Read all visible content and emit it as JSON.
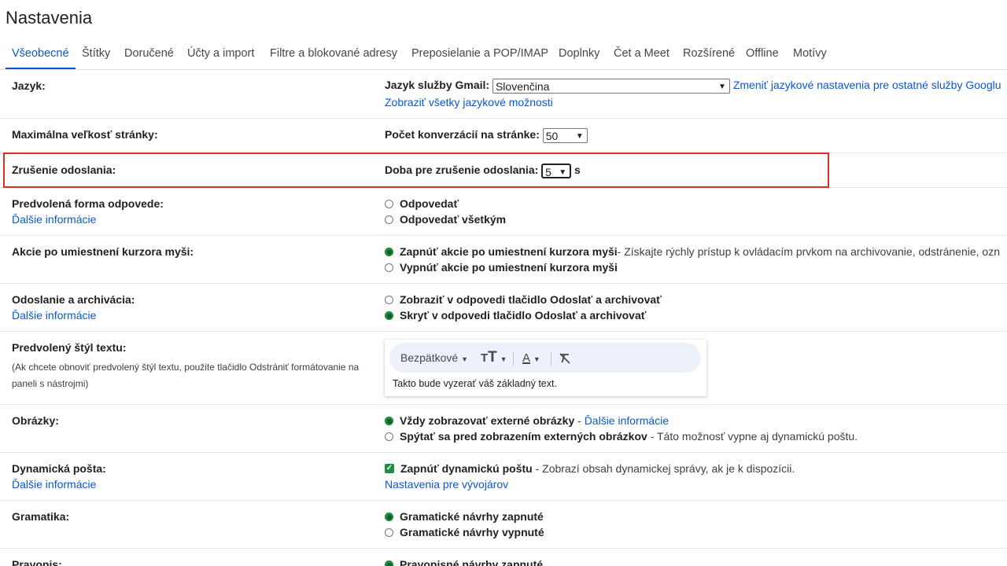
{
  "page_title": "Nastavenia",
  "tabs": [
    {
      "label": "Všeobecné",
      "active": true
    },
    {
      "label": "Štítky"
    },
    {
      "label": "Doručené"
    },
    {
      "label": "Účty a import"
    },
    {
      "label": "Filtre a blokované adresy"
    },
    {
      "label": "Preposielanie a POP/IMAP"
    },
    {
      "label": "Doplnky"
    },
    {
      "label": "Čet a Meet"
    },
    {
      "label": "Rozšírené"
    },
    {
      "label": "Offline"
    },
    {
      "label": "Motívy"
    }
  ],
  "language": {
    "label": "Jazyk:",
    "field_label": "Jazyk služby Gmail:",
    "value": "Slovenčina",
    "change_link": "Zmeniť jazykové nastavenia pre ostatné služby Googlu",
    "all_options_link": "Zobraziť všetky jazykové možnosti"
  },
  "page_size": {
    "label": "Maximálna veľkosť stránky:",
    "field_label": "Počet konverzácií na stránke:",
    "value": "50"
  },
  "undo_send": {
    "label": "Zrušenie odoslania:",
    "field_label": "Doba pre zrušenie odoslania:",
    "value": "5",
    "unit": "s",
    "highlight_color": "#d93025"
  },
  "reply_default": {
    "label": "Predvolená forma odpovede:",
    "more": "Ďalšie informácie",
    "options": [
      "Odpovedať",
      "Odpovedať všetkým"
    ],
    "selected": null
  },
  "hover_actions": {
    "label": "Akcie po umiestnení kurzora myši:",
    "on_label": "Zapnúť akcie po umiestnení kurzora myši",
    "on_desc": " - Získajte rýchly prístup k ovládacím prvkom na archivovanie, odstránenie, ozn",
    "off_label": "Vypnúť akcie po umiestnení kurzora myši",
    "selected": "on"
  },
  "send_archive": {
    "label": "Odoslanie a archivácia:",
    "more": "Ďalšie informácie",
    "options": [
      "Zobraziť v odpovedi tlačidlo Odoslať a archivovať",
      "Skryť v odpovedi tlačidlo Odoslať a archivovať"
    ],
    "selected": 1
  },
  "text_style": {
    "label": "Predvolený štýl textu:",
    "note": "(Ak chcete obnoviť predvolený štýl textu, použite tlačidlo Odstrániť formátovanie na paneli s nástrojmi)",
    "font": "Bezpätkové",
    "preview": "Takto bude vyzerať váš základný text."
  },
  "images": {
    "label": "Obrázky:",
    "opt1": "Vždy zobrazovať externé obrázky",
    "opt1_sep": " - ",
    "opt1_link": "Ďalšie informácie",
    "opt2": "Spýtať sa pred zobrazením externých obrázkov",
    "opt2_desc": " - Táto možnosť vypne aj dynamickú poštu.",
    "selected": 0
  },
  "dynamic_mail": {
    "label": "Dynamická pošta:",
    "more": "Ďalšie informácie",
    "checkbox_label": "Zapnúť dynamickú poštu",
    "checkbox_desc": " - Zobrazí obsah dynamickej správy, ak je k dispozícii.",
    "checked": true,
    "dev_link": "Nastavenia pre vývojárov"
  },
  "grammar": {
    "label": "Gramatika:",
    "options": [
      "Gramatické návrhy zapnuté",
      "Gramatické návrhy vypnuté"
    ],
    "selected": 0
  },
  "spelling": {
    "label": "Pravopis:",
    "option": "Pravopisné návrhy zapnuté"
  }
}
